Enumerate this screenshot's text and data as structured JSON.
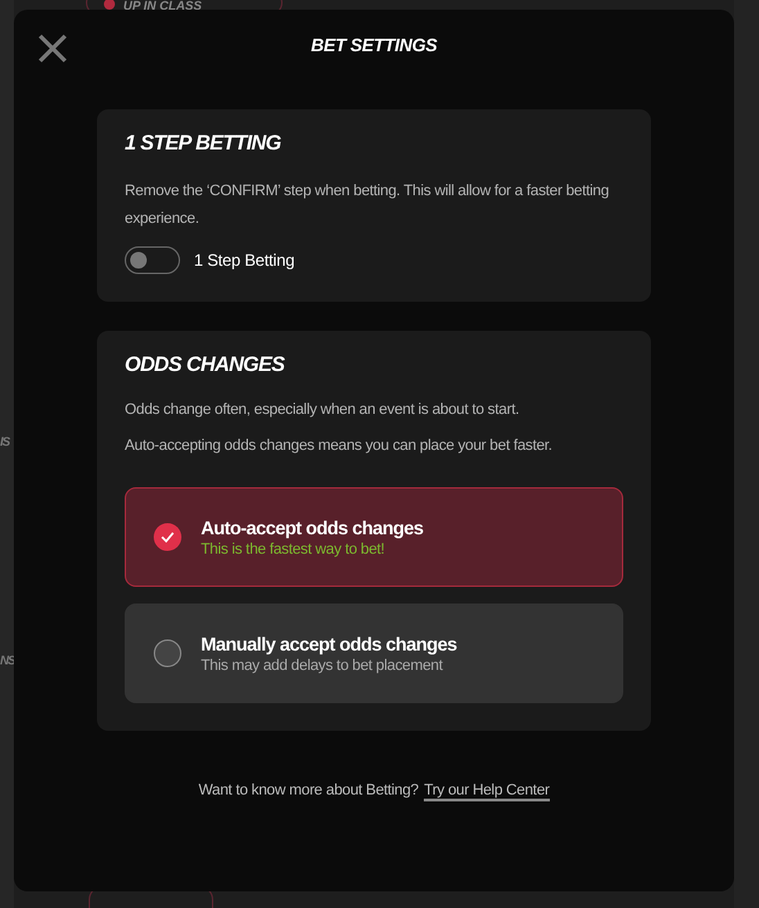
{
  "background": {
    "pill_label": "UP IN CLASS",
    "side_labels": [
      "IS",
      "NS"
    ]
  },
  "dialog": {
    "title": "BET SETTINGS"
  },
  "one_step": {
    "heading": "1 STEP BETTING",
    "description": "Remove the ‘CONFIRM’ step when betting. This will allow for a faster betting experience.",
    "toggle": {
      "label": "1 Step Betting",
      "on": false
    }
  },
  "odds_changes": {
    "heading": "ODDS CHANGES",
    "paragraphs": [
      "Odds change often, especially when an event is about to start.",
      "Auto-accepting odds changes means you can place your bet faster."
    ],
    "options": [
      {
        "title": "Auto-accept odds changes",
        "subtitle": "This is the fastest way to bet!",
        "selected": true
      },
      {
        "title": "Manually accept odds changes",
        "subtitle": "This may add delays to bet placement",
        "selected": false
      }
    ]
  },
  "footer": {
    "text": "Want to know more about Betting?",
    "link": "Try our Help Center"
  }
}
